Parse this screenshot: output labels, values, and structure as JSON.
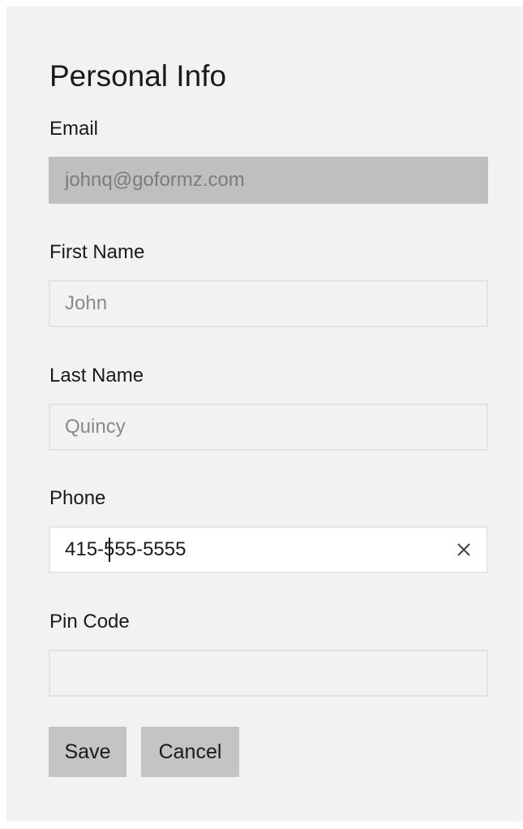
{
  "form": {
    "title": "Personal Info",
    "fields": [
      {
        "label": "Email",
        "value": "johnq@goformz.com",
        "state": "disabled"
      },
      {
        "label": "First Name",
        "value": "John",
        "state": "normal"
      },
      {
        "label": "Last Name",
        "value": "Quincy",
        "state": "normal"
      },
      {
        "label": "Phone",
        "value": "415-555-5555",
        "state": "focused",
        "clear_icon": "close-icon"
      },
      {
        "label": "Pin Code",
        "value": "",
        "state": "normal"
      }
    ],
    "buttons": {
      "save_label": "Save",
      "cancel_label": "Cancel"
    }
  },
  "colors": {
    "panel_bg": "#f2f2f2",
    "disabled_field_bg": "#bfbfbf",
    "button_bg": "#c4c4c4"
  }
}
